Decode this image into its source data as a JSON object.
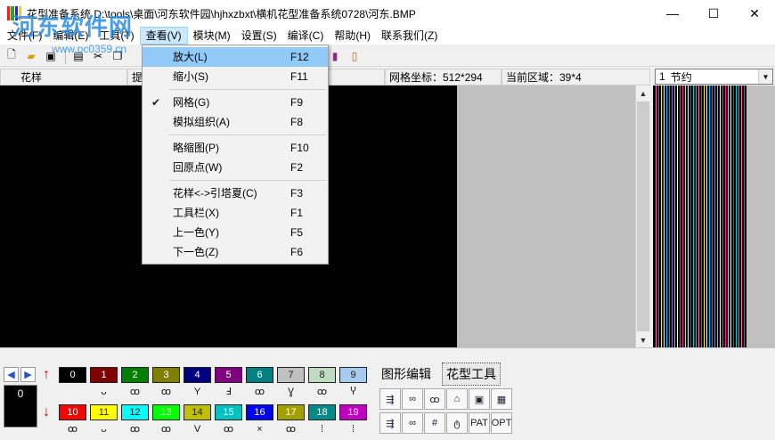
{
  "window": {
    "title": "花型准备系统 D:\\tools\\桌面\\河东软件园\\hjhxzbxt\\横机花型准备系统0728\\河东.BMP",
    "minimize": "—",
    "maximize": "☐",
    "close": "✕"
  },
  "watermark": {
    "text": "河东软件网",
    "url": "www.pc0359.cn"
  },
  "menubar": [
    {
      "label": "文件(F)"
    },
    {
      "label": "编辑(E)"
    },
    {
      "label": "工具(T)"
    },
    {
      "label": "查看(V)"
    },
    {
      "label": "模块(M)"
    },
    {
      "label": "设置(S)"
    },
    {
      "label": "编译(C)"
    },
    {
      "label": "帮助(H)"
    },
    {
      "label": "联系我们(Z)"
    }
  ],
  "header": {
    "pattern": "花样",
    "hint": "提",
    "grid_coord": "网格坐标：512*294",
    "current_area": "当前区域：39*4"
  },
  "combo": {
    "index": "1",
    "value": "节约"
  },
  "view_menu": [
    {
      "label": "放大(L)",
      "shortcut": "F12",
      "highlighted": true
    },
    {
      "label": "缩小(S)",
      "shortcut": "F11"
    },
    {
      "sep": true
    },
    {
      "label": "网格(G)",
      "shortcut": "F9",
      "checked": true,
      "check_mark": "✔"
    },
    {
      "label": "模拟组织(A)",
      "shortcut": "F8"
    },
    {
      "sep": true
    },
    {
      "label": "略缩图(P)",
      "shortcut": "F10"
    },
    {
      "label": "回原点(W)",
      "shortcut": "F2"
    },
    {
      "sep": true
    },
    {
      "label": "花样<->引塔夏(C)",
      "shortcut": "F3"
    },
    {
      "label": "工具栏(X)",
      "shortcut": "F1"
    },
    {
      "label": "上一色(Y)",
      "shortcut": "F5"
    },
    {
      "label": "下一色(Z)",
      "shortcut": "F6"
    }
  ],
  "current_color": "0",
  "palette_row1": [
    {
      "n": "0",
      "color": "#000000",
      "weave": ""
    },
    {
      "n": "1",
      "color": "#800000",
      "weave": "ᴗ"
    },
    {
      "n": "2",
      "color": "#008000",
      "weave": "ꝏ"
    },
    {
      "n": "3",
      "color": "#808000",
      "weave": "ꝏ"
    },
    {
      "n": "4",
      "color": "#000080",
      "weave": "Y"
    },
    {
      "n": "5",
      "color": "#800080",
      "weave": "Ⅎ"
    },
    {
      "n": "6",
      "color": "#008080",
      "weave": "ꝏ"
    },
    {
      "n": "7",
      "color": "#c0c0c0",
      "weave": "Ɣ"
    },
    {
      "n": "8",
      "color": "#c0dcc0",
      "weave": "ꝏ"
    },
    {
      "n": "9",
      "color": "#a6caf0",
      "weave": "Ⴤ"
    }
  ],
  "palette_row2": [
    {
      "n": "10",
      "color": "#ff0000",
      "weave": "ꝏ"
    },
    {
      "n": "11",
      "color": "#ffff00",
      "weave": "ᴗ"
    },
    {
      "n": "12",
      "color": "#00ffff",
      "weave": "ꝏ"
    },
    {
      "n": "13",
      "color": "#00ff00",
      "weave": "ꝏ"
    },
    {
      "n": "14",
      "color": "#c0c000",
      "weave": "V"
    },
    {
      "n": "15",
      "color": "#00c0c0",
      "weave": "ꝏ"
    },
    {
      "n": "16",
      "color": "#0000ff",
      "weave": "×"
    },
    {
      "n": "17",
      "color": "#a0a000",
      "weave": "ꝏ"
    },
    {
      "n": "18",
      "color": "#008b8b",
      "weave": "⁞"
    },
    {
      "n": "19",
      "color": "#c000c0",
      "weave": "⁞"
    }
  ],
  "tabs": {
    "graphic_edit": "图形编辑",
    "pattern_tool": "花型工具"
  },
  "tools_row1": [
    "⇶",
    "∞",
    "ꝏ",
    "⌂",
    "▣",
    "▦"
  ],
  "tools_row2": [
    "⇶",
    "∞",
    "#",
    "ტ",
    "PAT",
    "OPT"
  ],
  "stripe_colors": [
    "#ff69b4",
    "#4169e1",
    "#ffff00",
    "#ffffff",
    "#00bfff",
    "#ff4500",
    "#9370db",
    "#00ff7f",
    "#ffffff",
    "#1e90ff",
    "#ff1493",
    "#ffd700",
    "#ffffff",
    "#8a2be2",
    "#00ced1",
    "#ff6347"
  ]
}
